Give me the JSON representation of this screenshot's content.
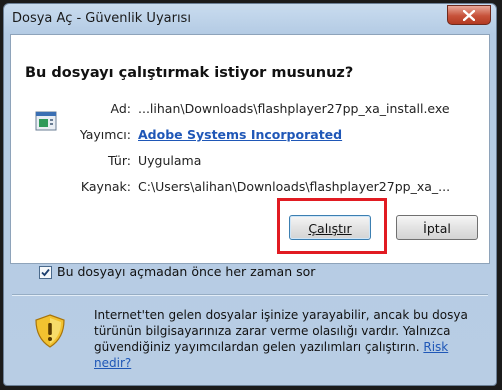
{
  "window": {
    "title": "Dosya Aç - Güvenlik Uyarısı",
    "question": "Bu dosyayı çalıştırmak istiyor musunuz?"
  },
  "info": {
    "name_label": "Ad:",
    "name_value": "...lihan\\Downloads\\flashplayer27pp_xa_install.exe",
    "publisher_label": "Yayımcı:",
    "publisher_value": "Adobe Systems Incorporated",
    "type_label": "Tür:",
    "type_value": "Uygulama",
    "source_label": "Kaynak:",
    "source_value": "C:\\Users\\alihan\\Downloads\\flashplayer27pp_xa_..."
  },
  "buttons": {
    "run_label": "Çalıştır",
    "cancel_label": "İptal"
  },
  "checkbox": {
    "label": "Bu dosyayı açmadan önce her zaman sor",
    "checked": true
  },
  "warning": {
    "text": "Internet'ten gelen dosyalar işinize yarayabilir, ancak bu dosya türünün bilgisayarınıza zarar verme olasılığı vardır. Yalnızca güvendiğiniz yayımcılardan gelen yazılımları çalıştırın.",
    "link": "Risk nedir?"
  },
  "colors": {
    "link": "#1f57b7",
    "highlight": "#e11b22"
  }
}
